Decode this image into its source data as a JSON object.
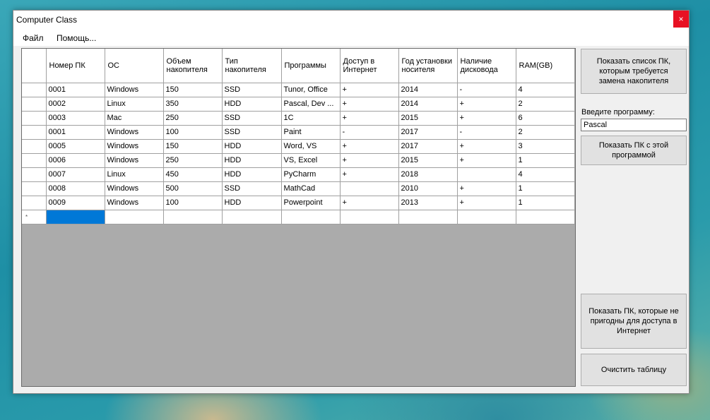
{
  "window": {
    "title": "Computer Class",
    "close_glyph": "×"
  },
  "menu": {
    "items": [
      "Файл",
      "Помощь..."
    ]
  },
  "grid": {
    "columns": [
      "Номер ПК",
      "ОС",
      "Объем накопителя",
      "Тип накопителя",
      "Программы",
      "Доступ в Интернет",
      "Год установки носителя",
      "Наличие дисковода",
      "RAM(GB)"
    ],
    "rows": [
      [
        "0001",
        "Windows",
        "150",
        "SSD",
        "Tunor, Office",
        "+",
        "2014",
        "-",
        "4"
      ],
      [
        "0002",
        "Linux",
        "350",
        "HDD",
        "Pascal, Dev ...",
        "+",
        "2014",
        "+",
        "2"
      ],
      [
        "0003",
        "Mac",
        "250",
        "SSD",
        "1C",
        "+",
        "2015",
        "+",
        "6"
      ],
      [
        "0001",
        "Windows",
        "100",
        "SSD",
        "Paint",
        "-",
        "2017",
        "-",
        "2"
      ],
      [
        "0005",
        "Windows",
        "150",
        "HDD",
        "Word, VS",
        "+",
        "2017",
        "+",
        "3"
      ],
      [
        "0006",
        "Windows",
        "250",
        "HDD",
        "VS, Excel",
        "+",
        "2015",
        "+",
        "1"
      ],
      [
        "0007",
        "Linux",
        "450",
        "HDD",
        "PyCharm",
        "+",
        "2018",
        "",
        "4"
      ],
      [
        "0008",
        "Windows",
        "500",
        "SSD",
        "MathCad",
        "",
        "2010",
        "+",
        "1"
      ],
      [
        "0009",
        "Windows",
        "100",
        "HDD",
        "Powerpoint",
        "+",
        "2013",
        "+",
        "1"
      ]
    ],
    "new_row_marker": "*"
  },
  "side": {
    "btn_replace": "Показать список ПК, которым требуется замена накопителя",
    "program_label": "Введите программу:",
    "program_value": "Pascal",
    "btn_with_program": "Показать ПК с этой программой",
    "btn_no_internet": "Показать ПК, которые не пригодны для доступа в Интернет",
    "btn_clear": "Очистить таблицу"
  },
  "colors": {
    "selection": "#0078d7",
    "close_button": "#e81123",
    "grid_empty_area": "#ababab"
  }
}
